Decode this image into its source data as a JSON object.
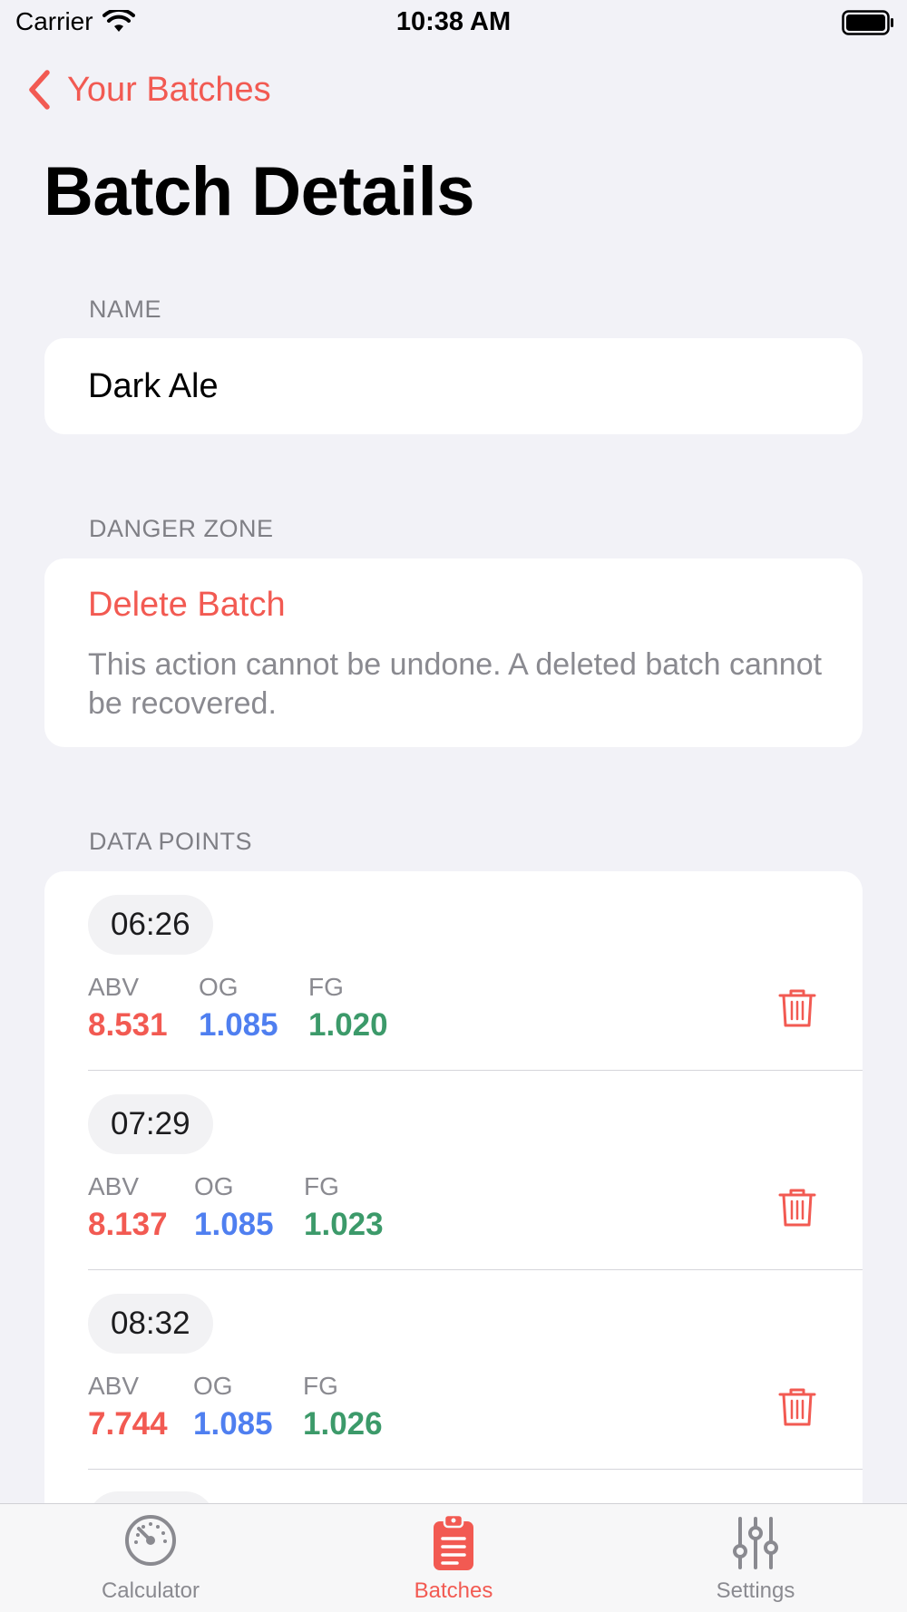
{
  "status_bar": {
    "carrier": "Carrier",
    "time": "10:38 AM"
  },
  "nav": {
    "back_label": "Your Batches",
    "title": "Batch Details"
  },
  "name_section": {
    "header": "NAME",
    "value": "Dark Ale"
  },
  "danger_section": {
    "header": "DANGER ZONE",
    "delete_label": "Delete Batch",
    "description": "This action cannot be undone. A deleted batch cannot be recovered."
  },
  "data_points_section": {
    "header": "DATA POINTS",
    "labels": {
      "abv": "ABV",
      "og": "OG",
      "fg": "FG"
    },
    "points": [
      {
        "time": "06:26",
        "abv": "8.531",
        "og": "1.085",
        "fg": "1.020"
      },
      {
        "time": "07:29",
        "abv": "8.137",
        "og": "1.085",
        "fg": "1.023"
      },
      {
        "time": "08:32",
        "abv": "7.744",
        "og": "1.085",
        "fg": "1.026"
      }
    ]
  },
  "tab_bar": {
    "tabs": [
      {
        "label": "Calculator",
        "icon": "gauge-icon"
      },
      {
        "label": "Batches",
        "icon": "clipboard-icon"
      },
      {
        "label": "Settings",
        "icon": "sliders-icon"
      }
    ],
    "active_index": 1
  },
  "colors": {
    "accent": "#f25a52",
    "abv": "#f25a52",
    "og": "#4f7ff0",
    "fg": "#3c9a6a"
  }
}
